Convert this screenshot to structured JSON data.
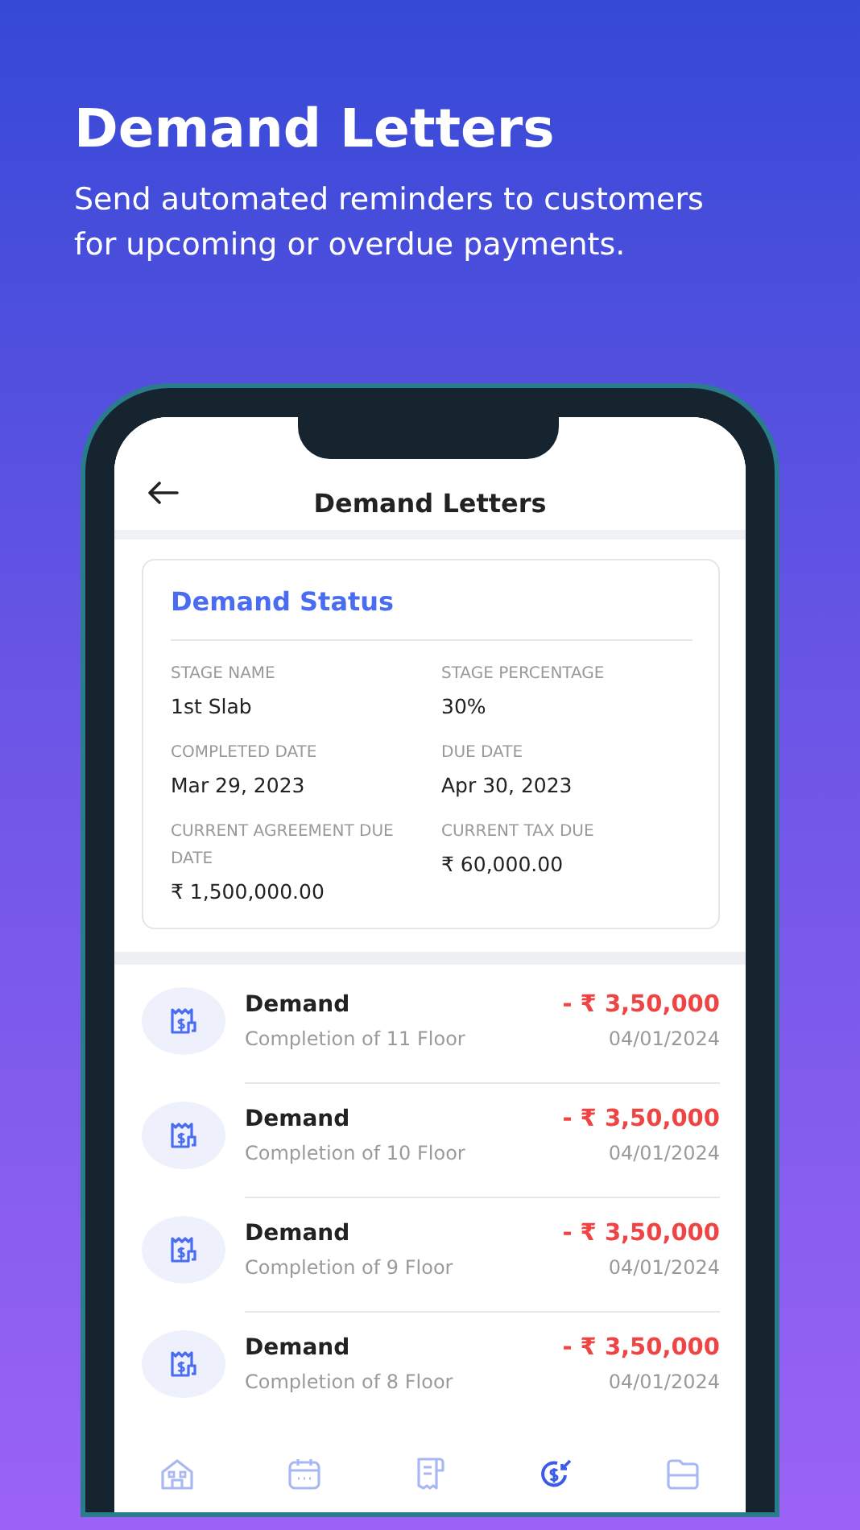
{
  "headline": "Demand Letters",
  "description": "Send automated reminders to customers for upcoming or overdue payments.",
  "app_bar": {
    "title": "Demand Letters"
  },
  "status_card": {
    "title": "Demand Status",
    "fields": [
      {
        "label": "STAGE NAME",
        "value": "1st Slab"
      },
      {
        "label": "STAGE PERCENTAGE",
        "value": "30%"
      },
      {
        "label": "COMPLETED DATE",
        "value": "Mar 29, 2023"
      },
      {
        "label": "DUE DATE",
        "value": "Apr 30, 2023"
      },
      {
        "label": "CURRENT AGREEMENT DUE DATE",
        "value": "₹ 1,500,000.00"
      },
      {
        "label": "CURRENT TAX DUE",
        "value": "₹ 60,000.00"
      }
    ]
  },
  "demands": [
    {
      "title": "Demand",
      "description": "Completion of 11 Floor",
      "amount": "- ₹ 3,50,000",
      "date": "04/01/2024"
    },
    {
      "title": "Demand",
      "description": "Completion of 10 Floor",
      "amount": "- ₹ 3,50,000",
      "date": "04/01/2024"
    },
    {
      "title": "Demand",
      "description": "Completion of 9 Floor",
      "amount": "- ₹ 3,50,000",
      "date": "04/01/2024"
    },
    {
      "title": "Demand",
      "description": "Completion of 8 Floor",
      "amount": "- ₹ 3,50,000",
      "date": "04/01/2024"
    }
  ],
  "nav": [
    {
      "kind": "home",
      "selected": false
    },
    {
      "kind": "calendar",
      "selected": false
    },
    {
      "kind": "receipt",
      "selected": false
    },
    {
      "kind": "payment",
      "selected": true
    },
    {
      "kind": "folder",
      "selected": false
    }
  ]
}
